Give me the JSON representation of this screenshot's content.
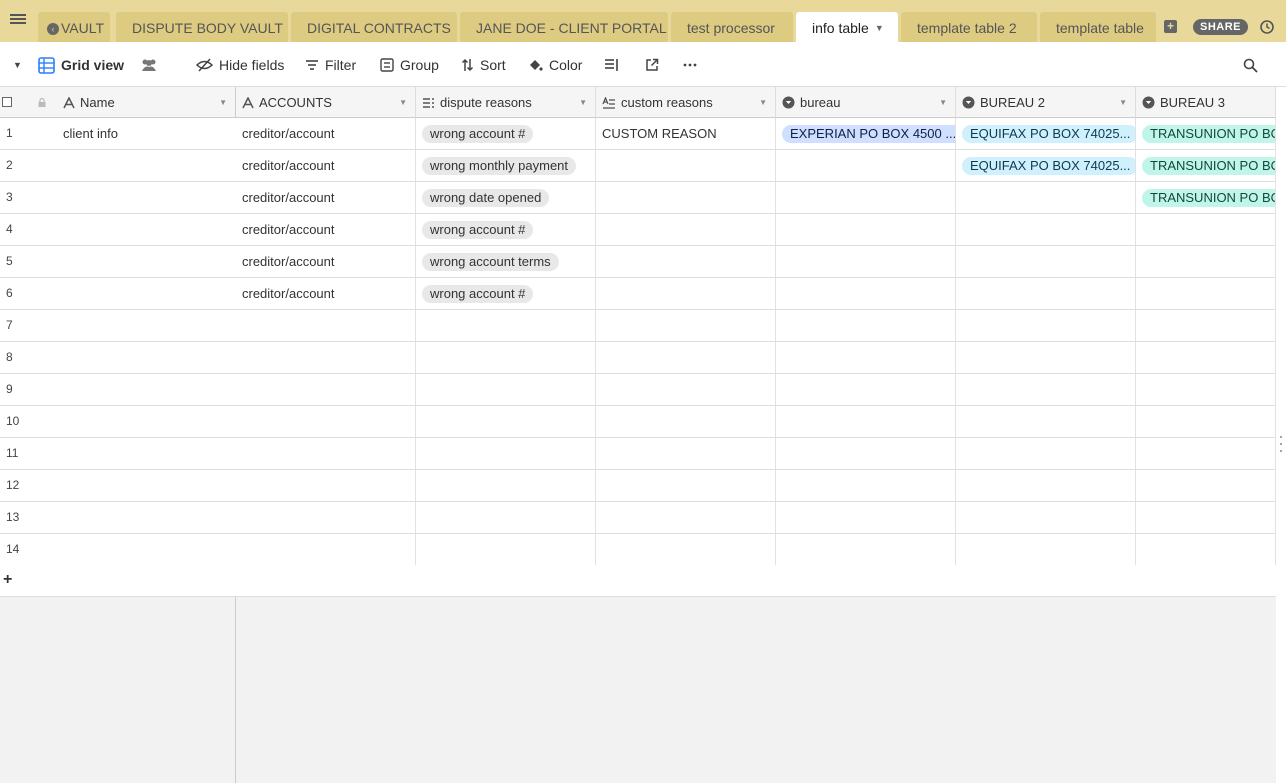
{
  "tabs": [
    {
      "label": "VAULT"
    },
    {
      "label": "DISPUTE BODY VAULT"
    },
    {
      "label": "DIGITAL CONTRACTS"
    },
    {
      "label": "JANE DOE - CLIENT PORTAL"
    },
    {
      "label": "test processor"
    },
    {
      "label": "info table"
    },
    {
      "label": "template table 2"
    },
    {
      "label": "template table"
    }
  ],
  "share_label": "SHARE",
  "toolbar": {
    "view_name": "Grid view",
    "hide_fields": "Hide fields",
    "filter": "Filter",
    "group": "Group",
    "sort": "Sort",
    "color": "Color"
  },
  "columns": [
    {
      "name": "Name",
      "icon": "text-icon"
    },
    {
      "name": "ACCOUNTS",
      "icon": "text-icon"
    },
    {
      "name": "dispute reasons",
      "icon": "multi-select-icon"
    },
    {
      "name": "custom reasons",
      "icon": "long-text-icon"
    },
    {
      "name": "bureau",
      "icon": "single-select-icon"
    },
    {
      "name": "BUREAU 2",
      "icon": "single-select-icon"
    },
    {
      "name": "BUREAU 3",
      "icon": "single-select-icon"
    }
  ],
  "rows": [
    {
      "num": "1",
      "name": "client info",
      "accounts": "creditor/account",
      "reason": "wrong account #",
      "custom": "CUSTOM REASON",
      "bureau": "EXPERIAN PO BOX 4500 ...",
      "bureau2": "EQUIFAX PO BOX 74025...",
      "bureau3": "TRANSUNION PO BOX"
    },
    {
      "num": "2",
      "name": "",
      "accounts": "creditor/account",
      "reason": "wrong monthly payment",
      "custom": "",
      "bureau": "",
      "bureau2": "EQUIFAX PO BOX 74025...",
      "bureau3": "TRANSUNION PO BOX"
    },
    {
      "num": "3",
      "name": "",
      "accounts": "creditor/account",
      "reason": "wrong date opened",
      "custom": "",
      "bureau": "",
      "bureau2": "",
      "bureau3": "TRANSUNION PO BOX"
    },
    {
      "num": "4",
      "name": "",
      "accounts": "creditor/account",
      "reason": "wrong account #",
      "custom": "",
      "bureau": "",
      "bureau2": "",
      "bureau3": ""
    },
    {
      "num": "5",
      "name": "",
      "accounts": "creditor/account",
      "reason": "wrong account terms",
      "custom": "",
      "bureau": "",
      "bureau2": "",
      "bureau3": ""
    },
    {
      "num": "6",
      "name": "",
      "accounts": "creditor/account",
      "reason": "wrong account #",
      "custom": "",
      "bureau": "",
      "bureau2": "",
      "bureau3": ""
    },
    {
      "num": "7",
      "name": "",
      "accounts": "",
      "reason": "",
      "custom": "",
      "bureau": "",
      "bureau2": "",
      "bureau3": ""
    },
    {
      "num": "8",
      "name": "",
      "accounts": "",
      "reason": "",
      "custom": "",
      "bureau": "",
      "bureau2": "",
      "bureau3": ""
    },
    {
      "num": "9",
      "name": "",
      "accounts": "",
      "reason": "",
      "custom": "",
      "bureau": "",
      "bureau2": "",
      "bureau3": ""
    },
    {
      "num": "10",
      "name": "",
      "accounts": "",
      "reason": "",
      "custom": "",
      "bureau": "",
      "bureau2": "",
      "bureau3": ""
    },
    {
      "num": "11",
      "name": "",
      "accounts": "",
      "reason": "",
      "custom": "",
      "bureau": "",
      "bureau2": "",
      "bureau3": ""
    },
    {
      "num": "12",
      "name": "",
      "accounts": "",
      "reason": "",
      "custom": "",
      "bureau": "",
      "bureau2": "",
      "bureau3": ""
    },
    {
      "num": "13",
      "name": "",
      "accounts": "",
      "reason": "",
      "custom": "",
      "bureau": "",
      "bureau2": "",
      "bureau3": ""
    },
    {
      "num": "14",
      "name": "",
      "accounts": "",
      "reason": "",
      "custom": "",
      "bureau": "",
      "bureau2": "",
      "bureau3": ""
    }
  ],
  "add_row_symbol": "+",
  "colors": {
    "tabbar_bg": "#e8d89a",
    "tab_bg": "#ddcb82",
    "pill_gray": "#e8e8e8",
    "pill_experian": "#cfdfff",
    "pill_equifax": "#d0f0fd",
    "pill_transunion": "#c2f5e9"
  }
}
